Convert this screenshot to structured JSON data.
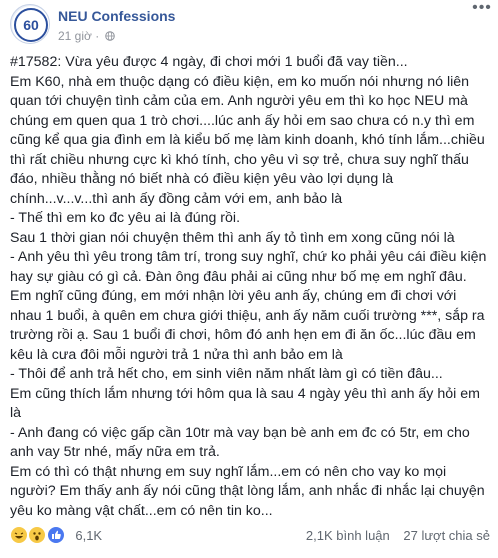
{
  "page": {
    "name": "NEU Confessions",
    "time": "21 giờ",
    "avatar_text": "60"
  },
  "post": {
    "paragraphs": [
      "#17582: Vừa yêu được 4 ngày, đi chơi mới 1 buổi đã vay tiền...",
      "Em K60, nhà em thuộc dạng có điều kiện, em ko muốn nói nhưng nó liên quan tới chuyện tình cảm của em. Anh người yêu em thì ko học NEU mà chúng em quen qua 1 trò chơi....lúc anh ấy hỏi em sao chưa có n.y thì em cũng kể qua gia đình em là kiểu bố mẹ làm kinh doanh, khó tính lắm...chiều thì rất chiều nhưng cực kì khó tính, cho yêu vì sợ trẻ, chưa suy nghĩ thấu đáo, nhiều thằng nó biết nhà có điều kiện yêu vào lợi dụng là chính...v...v...thì anh ấy đồng cảm với em, anh bảo là",
      "- Thế thì em ko đc yêu ai là đúng rồi.",
      "Sau 1 thời gian nói chuyện thêm thì anh ấy tỏ tình em xong cũng nói là",
      "- Anh yêu thì yêu trong tâm trí, trong suy nghĩ, chứ ko phải yêu cái điều kiện hay sự giàu có gì cả. Đàn ông đâu phải ai cũng như bố mẹ em nghĩ đâu.",
      "Em nghĩ cũng đúng, em mới nhận lời yêu anh ấy, chúng em đi chơi với nhau 1 buổi, à quên em chưa giới thiệu, anh ấy năm cuối trường ***, sắp ra trường rồi ạ. Sau 1 buổi đi chơi, hôm đó anh hẹn em đi ăn ốc...lúc đầu em kêu là cưa đôi mỗi người trả 1 nửa thì anh bảo em là",
      "- Thôi để anh trả hết cho, em sinh viên năm nhất làm gì có tiền đâu...",
      "Em cũng thích lắm nhưng tới hôm qua là sau 4 ngày yêu thì anh ấy hỏi em là",
      "- Anh đang có việc gấp cần 10tr mà vay bạn bè anh em đc có 5tr, em cho anh vay 5tr nhé, mấy nữa em trả.",
      "Em có thì có thật nhưng em suy nghĩ lắm...em có nên cho vay ko mọi người? Em thấy anh ấy nói cũng thật lòng lắm, anh nhắc đi nhắc lại chuyện yêu ko màng vật chất...em có nên tin ko..."
    ]
  },
  "footer": {
    "reaction_icons": [
      "haha-icon",
      "wow-icon",
      "like-icon"
    ],
    "reaction_count": "6,1K",
    "comments": "2,1K bình luận",
    "shares": "27 lượt chia sẻ"
  },
  "colors": {
    "page_name": "#365899",
    "text": "#1d2129",
    "meta": "#90949c",
    "like_blue": "#4a78f0",
    "emoji_yellow": "#f7c946"
  }
}
